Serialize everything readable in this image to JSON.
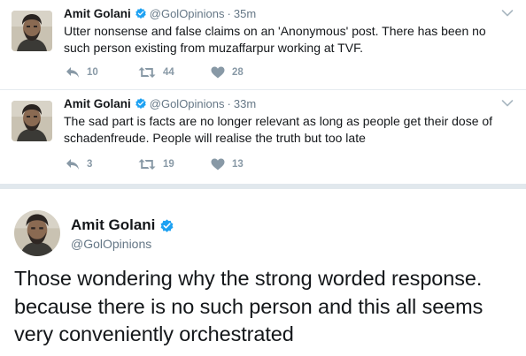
{
  "tweets": [
    {
      "name": "Amit Golani",
      "handle": "@GolOpinions",
      "separator": "·",
      "time": "35m",
      "text": "Utter nonsense and false claims on an 'Anonymous' post. There has been no such person existing from muzaffarpur working at TVF.",
      "replies": "10",
      "retweets": "44",
      "likes": "28"
    },
    {
      "name": "Amit Golani",
      "handle": "@GolOpinions",
      "separator": "·",
      "time": "33m",
      "text": "The sad part is facts are no longer relevant as long as people get their dose of schadenfreude. People will realise the truth but too late",
      "replies": "3",
      "retweets": "19",
      "likes": "13"
    }
  ],
  "featured": {
    "name": "Amit Golani",
    "handle": "@GolOpinions",
    "text": "Those wondering why the strong worded response. because there is no such person and this all seems very conveniently orchestrated"
  },
  "icons": {
    "verified": "verified-badge-icon",
    "reply": "reply-icon",
    "retweet": "retweet-icon",
    "like": "heart-icon",
    "menu": "chevron-down-icon"
  },
  "colors": {
    "verified": "#1da1f2",
    "muted": "#8899a6",
    "text": "#14171a",
    "handle": "#657786",
    "divider": "#e1e8ed"
  }
}
